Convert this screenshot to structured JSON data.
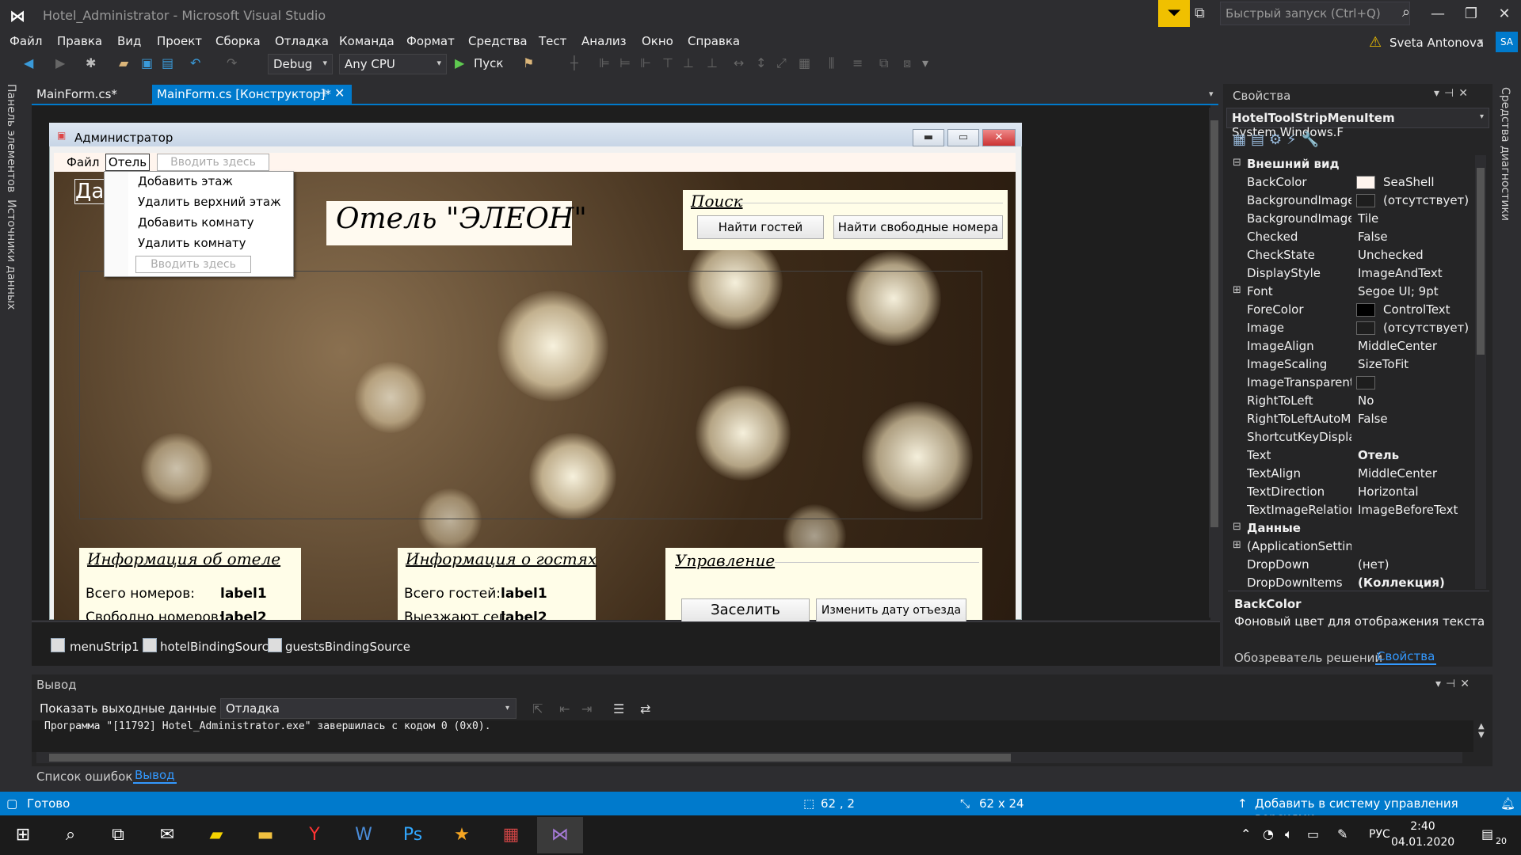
{
  "window": {
    "title": "Hotel_Administrator - Microsoft Visual Studio",
    "quick_launch_placeholder": "Быстрый запуск (Ctrl+Q)",
    "user_name": "Sveta Antonova",
    "user_initials": "SA"
  },
  "menubar": [
    "Файл",
    "Правка",
    "Вид",
    "Проект",
    "Сборка",
    "Отладка",
    "Команда",
    "Формат",
    "Средства",
    "Тест",
    "Анализ",
    "Окно",
    "Справка"
  ],
  "toolbar": {
    "config": "Debug",
    "platform": "Any CPU",
    "run_label": "Пуск"
  },
  "left_tabs": [
    "Панель элементов",
    "Источники данных"
  ],
  "doc_tabs": [
    {
      "label": "MainForm.cs*",
      "active": false
    },
    {
      "label": "MainForm.cs [Конструктор]*",
      "active": true
    }
  ],
  "form": {
    "title": "Администратор",
    "menu": {
      "file": "Файл",
      "hotel": "Отель",
      "type_here": "Вводить здесь"
    },
    "dropdown": [
      "Добавить этаж",
      "Удалить верхний этаж",
      "Добавить комнату",
      "Удалить комнату"
    ],
    "dropdown_type_here": "Вводить здесь",
    "date_label": "Да",
    "hotel_title": "Отель \"ЭЛЕОН\"",
    "search": {
      "title": "Поиск",
      "find_guests": "Найти гостей",
      "find_rooms": "Найти свободные номера"
    },
    "hotel_info": {
      "title": "Информация об отеле",
      "rooms_label": "Всего номеров:",
      "rooms_value": "label1",
      "free_label": "Свободно номеров:",
      "free_value": "label2"
    },
    "guest_info": {
      "title": "Информация о гостях",
      "guests_label": "Всего гостей:",
      "guests_value": "label1",
      "leaving_label": "Выезжают сег",
      "leaving_value": "label2"
    },
    "control": {
      "title": "Управление",
      "checkin": "Заселить",
      "change_date": "Изменить дату отъезда"
    }
  },
  "tray": [
    "menuStrip1",
    "hotelBindingSourc",
    "guestsBindingSource"
  ],
  "properties": {
    "title": "Свойства",
    "object_name": "HotelToolStripMenuItem",
    "object_type": "System.Windows.F",
    "rows": [
      {
        "kind": "cat",
        "name": "Внешний вид"
      },
      {
        "name": "BackColor",
        "value": "SeaShell",
        "swatch": "#fff5ee"
      },
      {
        "name": "BackgroundImage",
        "value": "(отсутствует)",
        "swatch": "#1e1e1e"
      },
      {
        "name": "BackgroundImageLa",
        "value": "Tile"
      },
      {
        "name": "Checked",
        "value": "False"
      },
      {
        "name": "CheckState",
        "value": "Unchecked"
      },
      {
        "name": "DisplayStyle",
        "value": "ImageAndText"
      },
      {
        "name": "Font",
        "value": "Segoe UI; 9pt",
        "expand": "⊞"
      },
      {
        "name": "ForeColor",
        "value": "ControlText",
        "swatch": "#000000"
      },
      {
        "name": "Image",
        "value": "(отсутствует)",
        "swatch": "#1e1e1e"
      },
      {
        "name": "ImageAlign",
        "value": "MiddleCenter"
      },
      {
        "name": "ImageScaling",
        "value": "SizeToFit"
      },
      {
        "name": "ImageTransparentCo",
        "value": "",
        "swatch": "#1e1e1e"
      },
      {
        "name": "RightToLeft",
        "value": "No"
      },
      {
        "name": "RightToLeftAutoMirr",
        "value": "False"
      },
      {
        "name": "ShortcutKeyDisplayS",
        "value": ""
      },
      {
        "name": "Text",
        "value": "Отель",
        "bold": true
      },
      {
        "name": "TextAlign",
        "value": "MiddleCenter"
      },
      {
        "name": "TextDirection",
        "value": "Horizontal"
      },
      {
        "name": "TextImageRelation",
        "value": "ImageBeforeText"
      },
      {
        "kind": "cat",
        "name": "Данные"
      },
      {
        "name": "(ApplicationSettings",
        "value": "",
        "expand": "⊞"
      },
      {
        "name": "DropDown",
        "value": "(нет)"
      },
      {
        "name": "DropDownItems",
        "value": "(Коллекция)",
        "bold": true
      }
    ],
    "desc_title": "BackColor",
    "desc_text": "Фоновый цвет для отображения текста и г...",
    "tab_solution": "Обозреватель решений",
    "tab_properties": "Свойства"
  },
  "right_tab": "Средства диагностики",
  "output": {
    "title": "Вывод",
    "show_label": "Показать выходные данные из:",
    "source": "Отладка",
    "text": "Программа \"[11792] Hotel_Administrator.exe\" завершилась с кодом 0 (0x0)."
  },
  "bottom_tabs": {
    "errors": "Список ошибок",
    "output": "Вывод"
  },
  "status": {
    "ready": "Готово",
    "position": "62 , 2",
    "size": "62 x 24",
    "vcs": "Добавить в систему управления версиями"
  },
  "taskbar": {
    "lang": "РУС",
    "time": "2:40",
    "date": "04.01.2020",
    "notif": "20"
  }
}
